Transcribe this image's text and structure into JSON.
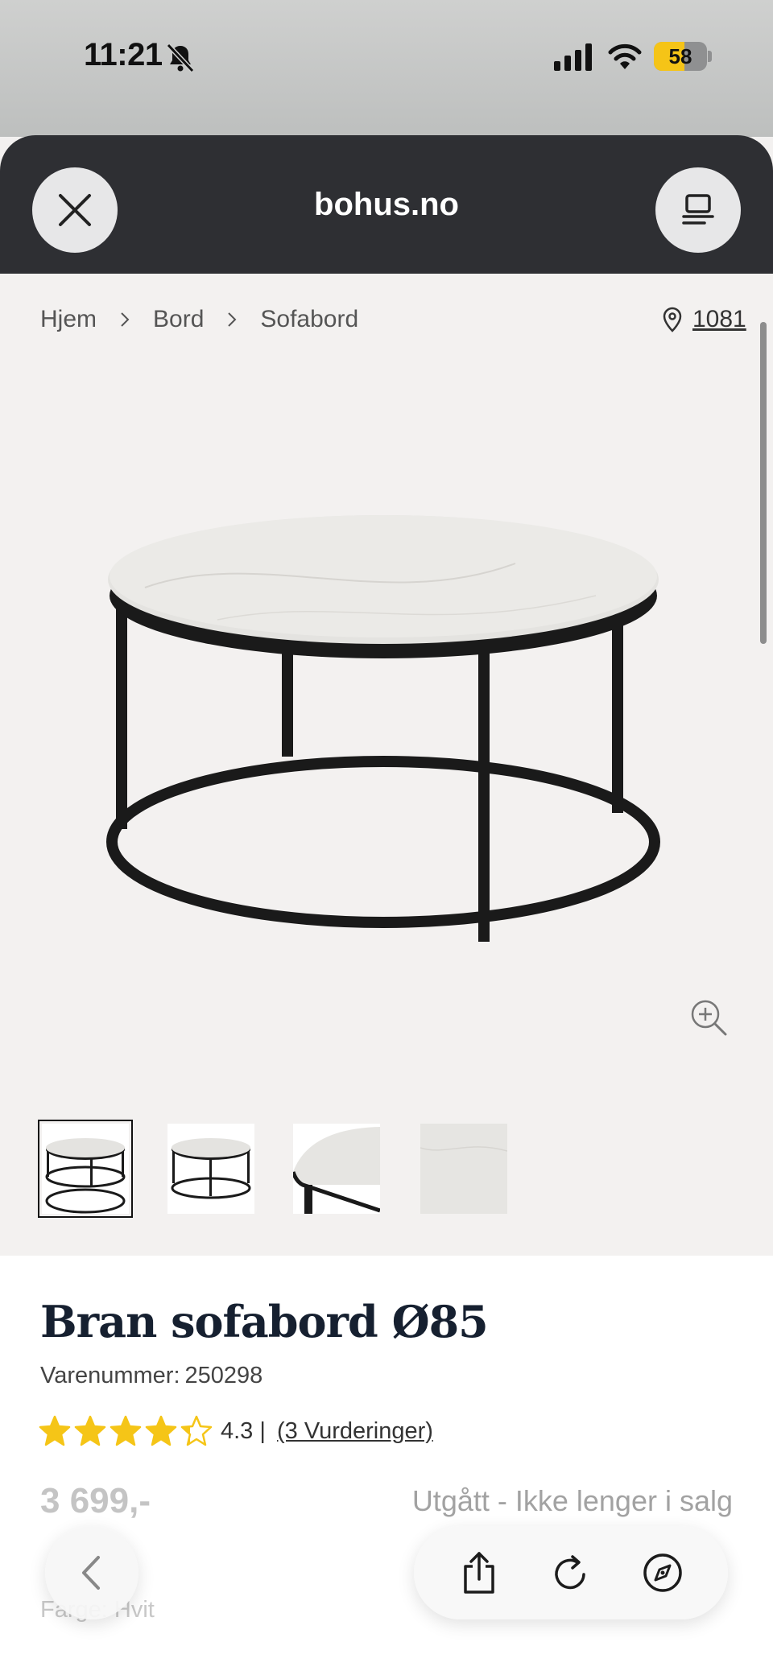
{
  "status_bar": {
    "time": "11:21",
    "battery_level": "58",
    "battery_fraction": 0.58
  },
  "browser": {
    "domain": "bohus.no"
  },
  "breadcrumb": {
    "items": [
      "Hjem",
      "Bord",
      "Sofabord"
    ],
    "store_code": "1081"
  },
  "gallery": {
    "thumbnail_count": 4,
    "active_index": 0
  },
  "product": {
    "title": "Bran sofabord Ø85",
    "sku_label": "Varenummer:",
    "sku": "250298",
    "rating": "4.3",
    "rating_value": 4.3,
    "rating_max": 5,
    "rating_separator": "|",
    "reviews": "(3 Vurderinger)",
    "price": "3 699,-",
    "availability": "Utgått - Ikke lenger i salg",
    "colour_label": "Farge: Hvit"
  },
  "colors": {
    "header_bg": "#2e2f33",
    "star": "#f5c517",
    "page_bg": "#f3f1f0"
  },
  "icons": {
    "close": "close-icon",
    "reader": "reader-icon",
    "pin": "location-pin-icon",
    "zoom": "zoom-in-icon",
    "back": "chevron-left-icon",
    "share": "share-icon",
    "reload": "reload-icon",
    "compass": "compass-icon"
  }
}
